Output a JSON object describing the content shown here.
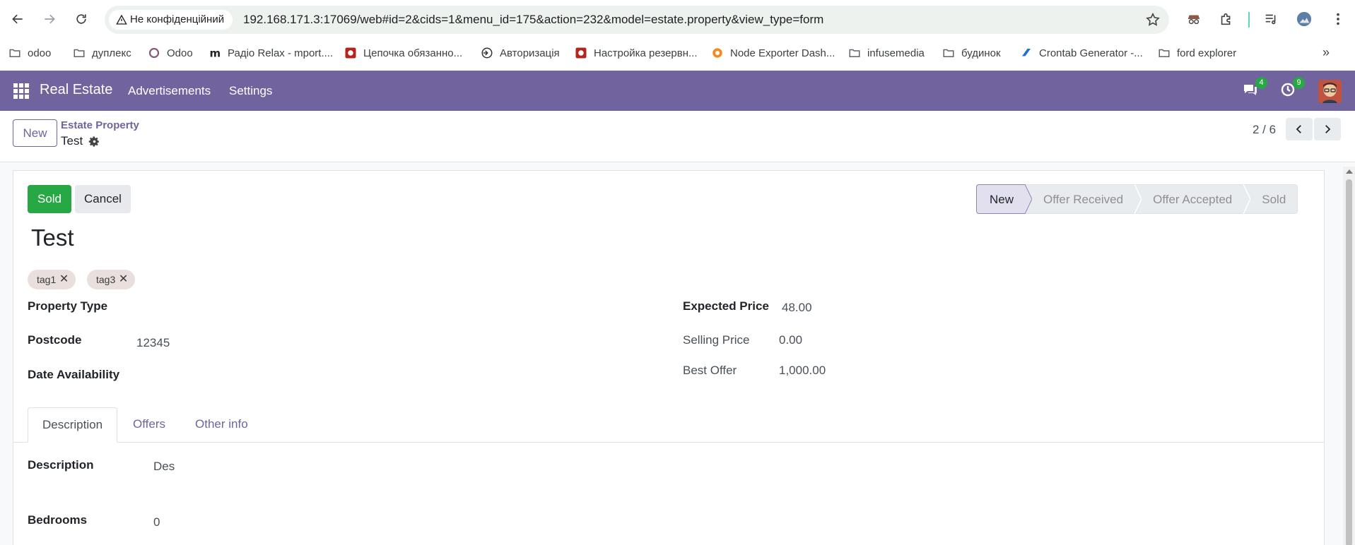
{
  "browser": {
    "security_label": "Не конфіденційний",
    "url": "192.168.171.3:17069/web#id=2&cids=1&menu_id=175&action=232&model=estate.property&view_type=form",
    "bookmarks": [
      {
        "label": "odoo",
        "icon": "folder-icon"
      },
      {
        "label": "дуплекс",
        "icon": "folder-icon"
      },
      {
        "label": "Odoo",
        "icon": "odoo-icon"
      },
      {
        "label": "Радіо Relax - mport....",
        "icon": "m-icon"
      },
      {
        "label": "Цепочка обязанно...",
        "icon": "site-icon"
      },
      {
        "label": "Авторизація",
        "icon": "login-icon"
      },
      {
        "label": "Настройка резервн...",
        "icon": "site-icon"
      },
      {
        "label": "Node Exporter Dash...",
        "icon": "grafana-icon"
      },
      {
        "label": "infusemedia",
        "icon": "folder-icon"
      },
      {
        "label": "будинок",
        "icon": "folder-icon"
      },
      {
        "label": "Crontab Generator -...",
        "icon": "crontab-icon"
      },
      {
        "label": "ford explorer",
        "icon": "folder-icon"
      }
    ],
    "more_label": "»"
  },
  "navbar": {
    "app_name": "Real Estate",
    "menus": [
      "Advertisements",
      "Settings"
    ],
    "messages_count": "4",
    "activities_count": "9"
  },
  "control_panel": {
    "new_label": "New",
    "breadcrumb_parent": "Estate Property",
    "breadcrumb_current": "Test",
    "pager": "2 / 6"
  },
  "form": {
    "buttons": {
      "sold": "Sold",
      "cancel": "Cancel"
    },
    "stages": [
      "New",
      "Offer Received",
      "Offer Accepted",
      "Sold"
    ],
    "active_stage": "New",
    "title": "Test",
    "tags": [
      "tag1",
      "tag3"
    ],
    "tag_remove": "✕",
    "fields_left": [
      {
        "label": "Property Type",
        "value": ""
      },
      {
        "label": "Postcode",
        "value": "12345"
      },
      {
        "label": "Date Availability",
        "value": ""
      }
    ],
    "fields_right": [
      {
        "label": "Expected Price",
        "value": "48.00"
      },
      {
        "label": "Selling Price",
        "value": "0.00"
      },
      {
        "label": "Best Offer",
        "value": "1,000.00"
      }
    ],
    "tabs": [
      "Description",
      "Offers",
      "Other info"
    ],
    "description_fields": [
      {
        "label": "Description",
        "value": "Des"
      },
      {
        "label": "Bedrooms",
        "value": "0"
      }
    ]
  },
  "colors": {
    "brand": "#71639e",
    "success": "#28a745"
  }
}
